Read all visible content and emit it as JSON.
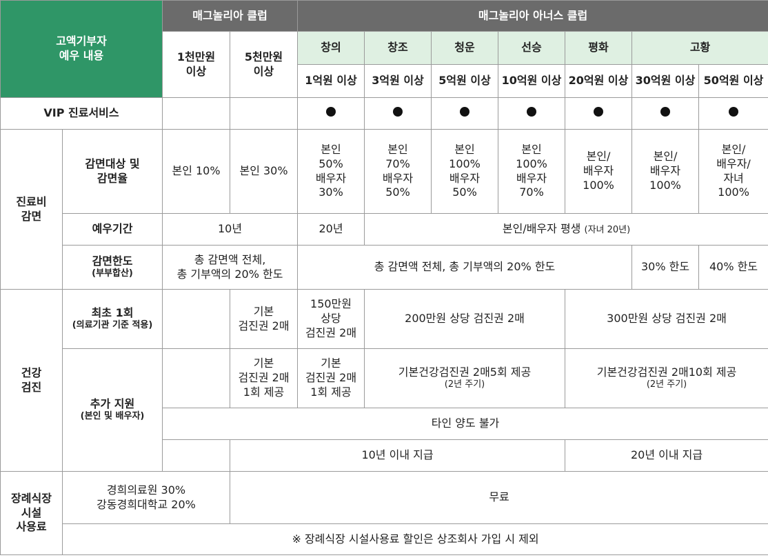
{
  "header": {
    "corner": "고액기부자\n예우 내용",
    "magnolia_club": "매그놀리아 클럽",
    "honors_club": "매그놀리아 아너스 클럽",
    "tier_10m": "1천만원\n이상",
    "tier_50m": "5천만원\n이상",
    "grades": [
      "창의",
      "창조",
      "청운",
      "선승",
      "평화",
      "고황"
    ],
    "amounts": [
      "1억원 이상",
      "3억원 이상",
      "5억원 이상",
      "10억원 이상",
      "20억원 이상",
      "30억원 이상",
      "50억원 이상"
    ]
  },
  "vip": {
    "label": "VIP 진료서비스",
    "dot_icon": "filled-circle-icon"
  },
  "medical": {
    "group_label": "진료비\n감면",
    "reduction_target_label": "감면대상 및\n감면율",
    "reduction_values": [
      "본인 10%",
      "본인 30%",
      "본인\n50%\n배우자\n30%",
      "본인\n70%\n배우자\n50%",
      "본인\n100%\n배우자\n50%",
      "본인\n100%\n배우자\n70%",
      "본인/\n배우자\n100%",
      "본인/\n배우자\n100%",
      "본인/\n배우자/\n자녀\n100%"
    ],
    "period_label": "예우기간",
    "period_10y": "10년",
    "period_20y": "20년",
    "period_lifetime_main": "본인/배우자 평생",
    "period_lifetime_note": "(자녀 20년)",
    "limit_label": "감면한도",
    "limit_sub": "(부부합산)",
    "limit_a": "총 감면액 전체,\n총 기부액의 20% 한도",
    "limit_b": "총 감면액 전체, 총 기부액의 20% 한도",
    "limit_c": "30% 한도",
    "limit_d": "40% 한도"
  },
  "health": {
    "group_label": "건강\n검진",
    "first_label": "최초 1회",
    "first_sub": "(의료기관 기준 적용)",
    "first_50m": "기본\n검진권 2매",
    "first_creativity": "150만원\n상당\n검진권 2매",
    "first_mid": "200만원 상당 검진권 2매",
    "first_high": "300만원 상당 검진권 2매",
    "extra_label": "추가 지원",
    "extra_sub": "(본인 및 배우자)",
    "extra_50m": "기본\n검진권 2매\n1회 제공",
    "extra_creativity": "기본\n검진권 2매\n1회 제공",
    "extra_mid_main": "기본건강검진권 2매5회 제공",
    "extra_mid_note": "(2년 주기)",
    "extra_high_main": "기본건강검진권 2매10회 제공",
    "extra_high_note": "(2년 주기)",
    "no_transfer": "타인 양도 불가",
    "within_10y": "10년 이내 지급",
    "within_20y": "20년 이내 지급"
  },
  "funeral": {
    "label": "장례식장\n시설\n사용료",
    "discount": "경희의료원 30%\n강동경희대학교 20%",
    "free": "무료",
    "note": "※ 장례식장 시설사용료 할인은 상조회사 가입 시 제외"
  },
  "colors": {
    "green": "#2f9667",
    "gray": "#6b6b6b",
    "light_green": "#dff0e2"
  }
}
